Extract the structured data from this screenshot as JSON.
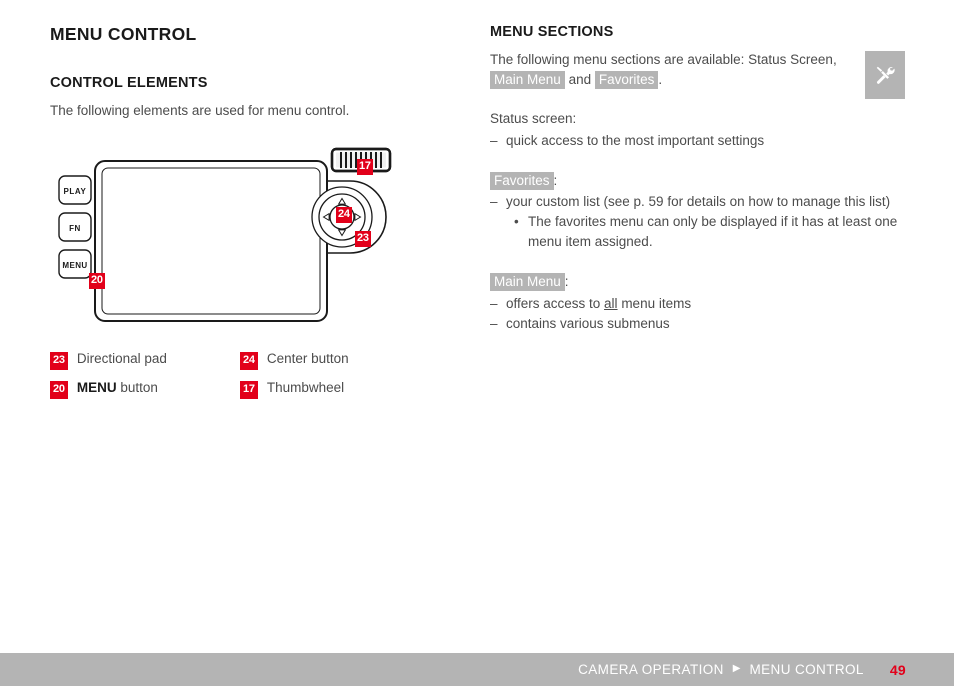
{
  "chapter": {
    "title": "MENU CONTROL"
  },
  "left": {
    "section_title": "CONTROL ELEMENTS",
    "intro": "The following elements are used for menu control.",
    "diagram": {
      "name": "camera-rear-diagram",
      "buttons": [
        "PLAY",
        "FN",
        "MENU"
      ],
      "markers": [
        {
          "id": "17",
          "target": "thumbwheel"
        },
        {
          "id": "24",
          "target": "center-button"
        },
        {
          "id": "23",
          "target": "directional-pad"
        },
        {
          "id": "20",
          "target": "menu-button"
        }
      ]
    },
    "legend": [
      {
        "num": "23",
        "label": "Directional pad",
        "bold_prefix": ""
      },
      {
        "num": "24",
        "label": "Center button",
        "bold_prefix": ""
      },
      {
        "num": "20",
        "label": "button",
        "bold_prefix": "MENU"
      },
      {
        "num": "17",
        "label": "Thumbwheel",
        "bold_prefix": ""
      }
    ]
  },
  "right": {
    "section_title": "MENU SECTIONS",
    "intro": {
      "part1": "The following menu sections are available: Status Screen,",
      "tag1": "Main Menu",
      "part2": "and",
      "tag2": "Favorites",
      "part3": "."
    },
    "groups": [
      {
        "label_plain": "Status screen:",
        "label_tag": "",
        "label_suffix": "",
        "items": [
          {
            "text": "quick access to the most important settings",
            "subitems": []
          }
        ]
      },
      {
        "label_plain": "",
        "label_tag": "Favorites",
        "label_suffix": ":",
        "items": [
          {
            "text": "your custom list (see p. 59 for details on how to manage this list)",
            "subitems": [
              "The favorites menu can only be displayed if it has at least one menu item assigned."
            ]
          }
        ]
      },
      {
        "label_plain": "",
        "label_tag": "Main Menu",
        "label_suffix": ":",
        "items": [
          {
            "text_before": "offers access to ",
            "text_underline": "all",
            "text_after": " menu items",
            "subitems": []
          },
          {
            "text": "contains various submenus",
            "subitems": []
          }
        ]
      }
    ],
    "tools_button": {
      "icon": "tools-icon",
      "aria": "Tools"
    }
  },
  "footer": {
    "breadcrumb_1": "CAMERA OPERATION",
    "arrow": "▶",
    "breadcrumb_2": "MENU CONTROL",
    "page_number": "49"
  },
  "colors": {
    "accent_red": "#e2001a",
    "gray_bar": "#b4b4b4",
    "body_text": "#4c4c4c",
    "heading": "#1a1a1a"
  }
}
